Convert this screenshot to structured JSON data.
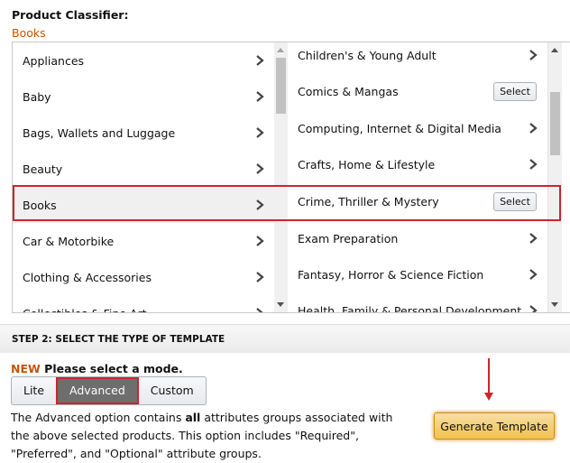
{
  "header": {
    "title": "Product Classifier:",
    "breadcrumb": "Books"
  },
  "left_column": {
    "items": [
      {
        "label": "Appliances",
        "action": "chevron"
      },
      {
        "label": "Baby",
        "action": "chevron"
      },
      {
        "label": "Bags, Wallets and Luggage",
        "action": "chevron"
      },
      {
        "label": "Beauty",
        "action": "chevron"
      },
      {
        "label": "Books",
        "action": "chevron",
        "selected": true
      },
      {
        "label": "Car & Motorbike",
        "action": "chevron"
      },
      {
        "label": "Clothing & Accessories",
        "action": "chevron"
      },
      {
        "label": "Collectibles & Fine Art",
        "action": "chevron"
      }
    ]
  },
  "right_column": {
    "items": [
      {
        "label": "Children's & Young Adult",
        "action": "chevron"
      },
      {
        "label": "Comics & Mangas",
        "action": "select",
        "button": "Select"
      },
      {
        "label": "Computing, Internet & Digital Media",
        "action": "chevron"
      },
      {
        "label": "Crafts, Home & Lifestyle",
        "action": "chevron"
      },
      {
        "label": "Crime, Thriller & Mystery",
        "action": "select",
        "button": "Select",
        "highlighted": true
      },
      {
        "label": "Exam Preparation",
        "action": "chevron"
      },
      {
        "label": "Fantasy, Horror & Science Fiction",
        "action": "chevron"
      },
      {
        "label": "Health, Family & Personal Development",
        "action": "chevron"
      }
    ]
  },
  "step2": {
    "heading": "STEP 2: SELECT THE TYPE OF TEMPLATE",
    "new_tag": "NEW",
    "prompt": "Please select a mode.",
    "modes": [
      "Lite",
      "Advanced",
      "Custom"
    ],
    "selected_mode": "Advanced",
    "desc_1": "The Advanced option contains ",
    "desc_bold": "all",
    "desc_2": " attributes groups associated with the above selected products. This option includes \"Required\", \"Preferred\", and \"Optional\" attribute groups.",
    "generate_button": "Generate Template"
  },
  "colors": {
    "accent": "#c45500",
    "highlight": "#c7272d",
    "primary_button": "#f0c14b"
  }
}
